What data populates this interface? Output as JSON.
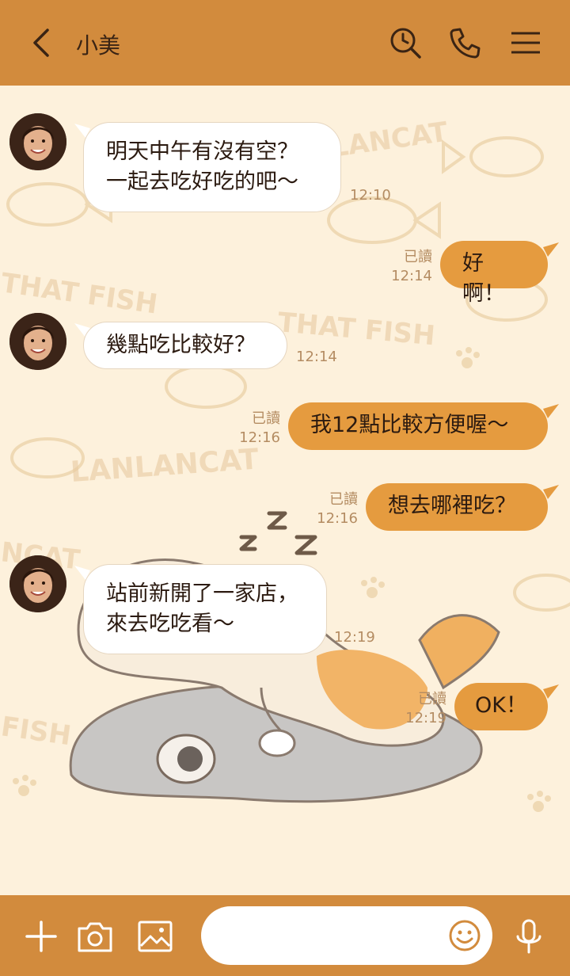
{
  "header": {
    "contact_name": "小美"
  },
  "colors": {
    "header_bg": "#d28b3d",
    "chat_bg": "#fdf1dc",
    "my_bubble": "#e59b3f",
    "their_bubble": "#ffffff"
  },
  "icons": {
    "back": "chevron-left-icon",
    "search": "search-clock-icon",
    "call": "phone-icon",
    "menu": "hamburger-icon",
    "plus": "plus-icon",
    "camera": "camera-icon",
    "image": "image-icon",
    "emoji": "smiley-icon",
    "mic": "microphone-icon"
  },
  "messages": [
    {
      "from": "them",
      "lines": [
        "明天中午有沒有空？",
        "一起去吃好吃的吧～"
      ],
      "time": "12:10"
    },
    {
      "from": "me",
      "lines": [
        "好啊！"
      ],
      "read": "已讀",
      "time": "12:14"
    },
    {
      "from": "them",
      "lines": [
        "幾點吃比較好？"
      ],
      "time": "12:14"
    },
    {
      "from": "me",
      "lines": [
        "我12點比較方便喔～"
      ],
      "read": "已讀",
      "time": "12:16"
    },
    {
      "from": "me",
      "lines": [
        "想去哪裡吃？"
      ],
      "read": "已讀",
      "time": "12:16"
    },
    {
      "from": "them",
      "lines": [
        "站前新開了一家店，",
        "來去吃吃看～"
      ],
      "time": "12:19"
    },
    {
      "from": "me",
      "lines": [
        "OK！"
      ],
      "read": "已讀",
      "time": "12:19"
    }
  ],
  "input": {
    "value": "",
    "placeholder": ""
  }
}
